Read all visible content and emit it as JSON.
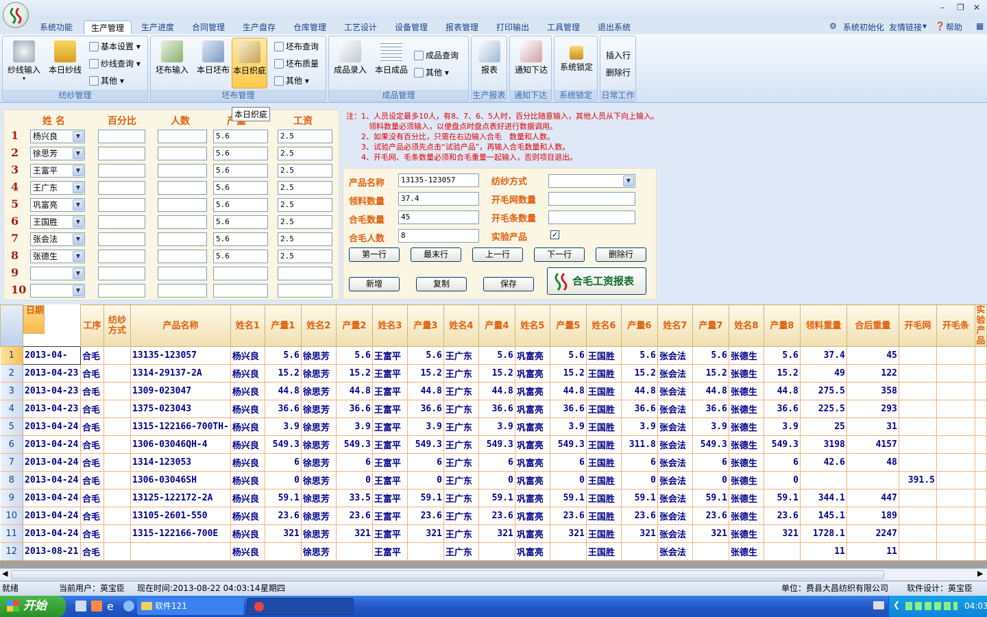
{
  "window": {
    "min_label": "–",
    "max_label": "❐",
    "close_label": "✕"
  },
  "menu": {
    "tabs": [
      "系统功能",
      "生产管理",
      "生产进度",
      "合同管理",
      "生产盘存",
      "仓库管理",
      "工艺设计",
      "设备管理",
      "报表管理",
      "打印输出",
      "工具管理",
      "退出系统"
    ],
    "right": {
      "init": "系统初始化",
      "links": "友情链接",
      "help": "帮助"
    }
  },
  "ribbon": {
    "groups": {
      "yarn": "纺纱管理",
      "cloth": "坯布管理",
      "product": "成品管理",
      "report": "生产报表",
      "notice": "通知下达",
      "lock": "系统锁定",
      "daily": "日常工作"
    },
    "yarn_input": "纱线输入",
    "yarn_today": "本日纱线",
    "basic_settings": "基本设置",
    "yarn_query": "纱线查询",
    "yarn_other": "其他",
    "cloth_input": "坯布输入",
    "cloth_today": "本日坯布",
    "cloth_flaw": "本日织疵",
    "cloth_query": "坯布查询",
    "cloth_quality": "坯布质量",
    "cloth_other": "其他",
    "product_entry": "成品录入",
    "product_today": "本日成品",
    "product_query": "成品查询",
    "product_other": "其他",
    "report": "报表",
    "notice": "通知下达",
    "lock": "系统锁定",
    "insert_row": "插入行",
    "delete_row": "删除行",
    "tooltip": "本日织疵"
  },
  "form": {
    "headers": {
      "name": "姓 名",
      "percent": "百分比",
      "people": "人数",
      "output": "产量",
      "wage": "工资"
    },
    "rows": [
      {
        "n": "1",
        "name": "杨兴良",
        "percent": "",
        "people": "",
        "output": "5.6",
        "wage": "2.5"
      },
      {
        "n": "2",
        "name": "徐思芳",
        "percent": "",
        "people": "",
        "output": "5.6",
        "wage": "2.5"
      },
      {
        "n": "3",
        "name": "王富平",
        "percent": "",
        "people": "",
        "output": "5.6",
        "wage": "2.5"
      },
      {
        "n": "4",
        "name": "王广东",
        "percent": "",
        "people": "",
        "output": "5.6",
        "wage": "2.5"
      },
      {
        "n": "5",
        "name": "巩富亮",
        "percent": "",
        "people": "",
        "output": "5.6",
        "wage": "2.5"
      },
      {
        "n": "6",
        "name": "王国胜",
        "percent": "",
        "people": "",
        "output": "5.6",
        "wage": "2.5"
      },
      {
        "n": "7",
        "name": "张会法",
        "percent": "",
        "people": "",
        "output": "5.6",
        "wage": "2.5"
      },
      {
        "n": "8",
        "name": "张德生",
        "percent": "",
        "people": "",
        "output": "5.6",
        "wage": "2.5"
      },
      {
        "n": "9",
        "name": "",
        "percent": "",
        "people": "",
        "output": "",
        "wage": ""
      },
      {
        "n": "10",
        "name": "",
        "percent": "",
        "people": "",
        "output": "",
        "wage": ""
      }
    ]
  },
  "notes": [
    "注：1、人员设定最多10人，有8、7、6、5人时，百分比随意输入，其他人员从下向上输入。",
    "　　　领料数量必须输入，以便盘点时盘点表好进行数据调用。",
    "　　2、如果没有百分比，只需在右边输入合毛　数量和人数。",
    "　　3、试验产品必须先点击“试验产品”，再输入合毛数量和人数。",
    "　　4、开毛网、毛条数量必须和合毛重量一起输入，否则项目退出。"
  ],
  "product": {
    "name_label": "产品名称",
    "name_value": "13135-123057",
    "spin_label": "纺纱方式",
    "spin_value": "",
    "material_label": "领料数量",
    "material_value": "37.4",
    "net_label": "开毛网数量",
    "net_value": "",
    "hemao_label": "合毛数量",
    "hemao_value": "45",
    "strip_label": "开毛条数量",
    "strip_value": "",
    "people_label": "合毛人数",
    "people_value": "8",
    "trial_label": "实验产品",
    "trial_checked": "✓"
  },
  "buttons": {
    "first": "第一行",
    "last": "最末行",
    "prev": "上一行",
    "next": "下一行",
    "delete": "删除行",
    "add": "新增",
    "copy": "复制",
    "save": "保存",
    "report": "合毛工资报表"
  },
  "grid": {
    "headers": [
      "日期",
      "工序",
      "纺纱方式",
      "产品名称",
      "姓名1",
      "产量1",
      "姓名2",
      "产量2",
      "姓名3",
      "产量3",
      "姓名4",
      "产量4",
      "姓名5",
      "产量5",
      "姓名6",
      "产量6",
      "姓名7",
      "产量7",
      "姓名8",
      "产量8",
      "领料重量",
      "合后重量",
      "开毛网",
      "开毛条",
      "实验产品"
    ],
    "rows": [
      {
        "n": "1",
        "c": [
          "2013-04-",
          "合毛",
          "",
          "13135-123057",
          "杨兴良",
          "5.6",
          "徐思芳",
          "5.6",
          "王富平",
          "5.6",
          "王广东",
          "5.6",
          "巩富亮",
          "5.6",
          "王国胜",
          "5.6",
          "张会法",
          "5.6",
          "张德生",
          "5.6",
          "37.4",
          "45",
          "",
          "",
          ""
        ]
      },
      {
        "n": "2",
        "c": [
          "2013-04-23",
          "合毛",
          "",
          "1314-29137-2A",
          "杨兴良",
          "15.2",
          "徐思芳",
          "15.2",
          "王富平",
          "15.2",
          "王广东",
          "15.2",
          "巩富亮",
          "15.2",
          "王国胜",
          "15.2",
          "张会法",
          "15.2",
          "张德生",
          "15.2",
          "49",
          "122",
          "",
          "",
          ""
        ]
      },
      {
        "n": "3",
        "c": [
          "2013-04-23",
          "合毛",
          "",
          "1309-023047",
          "杨兴良",
          "44.8",
          "徐思芳",
          "44.8",
          "王富平",
          "44.8",
          "王广东",
          "44.8",
          "巩富亮",
          "44.8",
          "王国胜",
          "44.8",
          "张会法",
          "44.8",
          "张德生",
          "44.8",
          "275.5",
          "358",
          "",
          "",
          ""
        ]
      },
      {
        "n": "4",
        "c": [
          "2013-04-23",
          "合毛",
          "",
          "1375-023043",
          "杨兴良",
          "36.6",
          "徐思芳",
          "36.6",
          "王富平",
          "36.6",
          "王广东",
          "36.6",
          "巩富亮",
          "36.6",
          "王国胜",
          "36.6",
          "张会法",
          "36.6",
          "张德生",
          "36.6",
          "225.5",
          "293",
          "",
          "",
          ""
        ]
      },
      {
        "n": "5",
        "c": [
          "2013-04-24",
          "合毛",
          "",
          "1315-122166-700TH-",
          "杨兴良",
          "3.9",
          "徐思芳",
          "3.9",
          "王富平",
          "3.9",
          "王广东",
          "3.9",
          "巩富亮",
          "3.9",
          "王国胜",
          "3.9",
          "张会法",
          "3.9",
          "张德生",
          "3.9",
          "25",
          "31",
          "",
          "",
          ""
        ]
      },
      {
        "n": "6",
        "c": [
          "2013-04-24",
          "合毛",
          "",
          "1306-03046QH-4",
          "杨兴良",
          "549.3",
          "徐思芳",
          "549.3",
          "王富平",
          "549.3",
          "王广东",
          "549.3",
          "巩富亮",
          "549.3",
          "王国胜",
          "311.8",
          "张会法",
          "549.3",
          "张德生",
          "549.3",
          "3198",
          "4157",
          "",
          "",
          ""
        ]
      },
      {
        "n": "7",
        "c": [
          "2013-04-24",
          "合毛",
          "",
          "1314-123053",
          "杨兴良",
          "6",
          "徐思芳",
          "6",
          "王富平",
          "6",
          "王广东",
          "6",
          "巩富亮",
          "6",
          "王国胜",
          "6",
          "张会法",
          "6",
          "张德生",
          "6",
          "42.6",
          "48",
          "",
          "",
          ""
        ]
      },
      {
        "n": "8",
        "c": [
          "2013-04-24",
          "合毛",
          "",
          "1306-03046SH",
          "杨兴良",
          "0",
          "徐思芳",
          "0",
          "王富平",
          "0",
          "王广东",
          "0",
          "巩富亮",
          "0",
          "王国胜",
          "0",
          "张会法",
          "0",
          "张德生",
          "0",
          "",
          "",
          "391.5",
          "",
          ""
        ]
      },
      {
        "n": "9",
        "c": [
          "2013-04-24",
          "合毛",
          "",
          "13125-122172-2A",
          "杨兴良",
          "59.1",
          "徐思芳",
          "33.5",
          "王富平",
          "59.1",
          "王广东",
          "59.1",
          "巩富亮",
          "59.1",
          "王国胜",
          "59.1",
          "张会法",
          "59.1",
          "张德生",
          "59.1",
          "344.1",
          "447",
          "",
          "",
          ""
        ]
      },
      {
        "n": "10",
        "c": [
          "2013-04-24",
          "合毛",
          "",
          "13105-2601-550",
          "杨兴良",
          "23.6",
          "徐思芳",
          "23.6",
          "王富平",
          "23.6",
          "王广东",
          "23.6",
          "巩富亮",
          "23.6",
          "王国胜",
          "23.6",
          "张会法",
          "23.6",
          "张德生",
          "23.6",
          "145.1",
          "189",
          "",
          "",
          ""
        ]
      },
      {
        "n": "11",
        "c": [
          "2013-04-24",
          "合毛",
          "",
          "1315-122166-700E",
          "杨兴良",
          "321",
          "徐思芳",
          "321",
          "王富平",
          "321",
          "王广东",
          "321",
          "巩富亮",
          "321",
          "王国胜",
          "321",
          "张会法",
          "321",
          "张德生",
          "321",
          "1728.1",
          "2247",
          "",
          "",
          ""
        ]
      },
      {
        "n": "12",
        "c": [
          "2013-08-21",
          "合毛",
          "",
          "",
          "杨兴良",
          "",
          "徐思芳",
          "",
          "王富平",
          "",
          "王广东",
          "",
          "巩富亮",
          "",
          "王国胜",
          "",
          "张会法",
          "",
          "张德生",
          "",
          "11",
          "11",
          "",
          "",
          ""
        ]
      }
    ]
  },
  "status": {
    "ready": "就绪",
    "user": "当前用户：英宝臣",
    "time": "现在时间:2013-08-22 04:03:14",
    "weekday": "星期四",
    "unit": "单位：费县大昌纺织有限公司",
    "designer": "软件设计：英宝臣"
  },
  "taskbar": {
    "start": "开始",
    "task1": "软件121",
    "clock": "04:03"
  }
}
